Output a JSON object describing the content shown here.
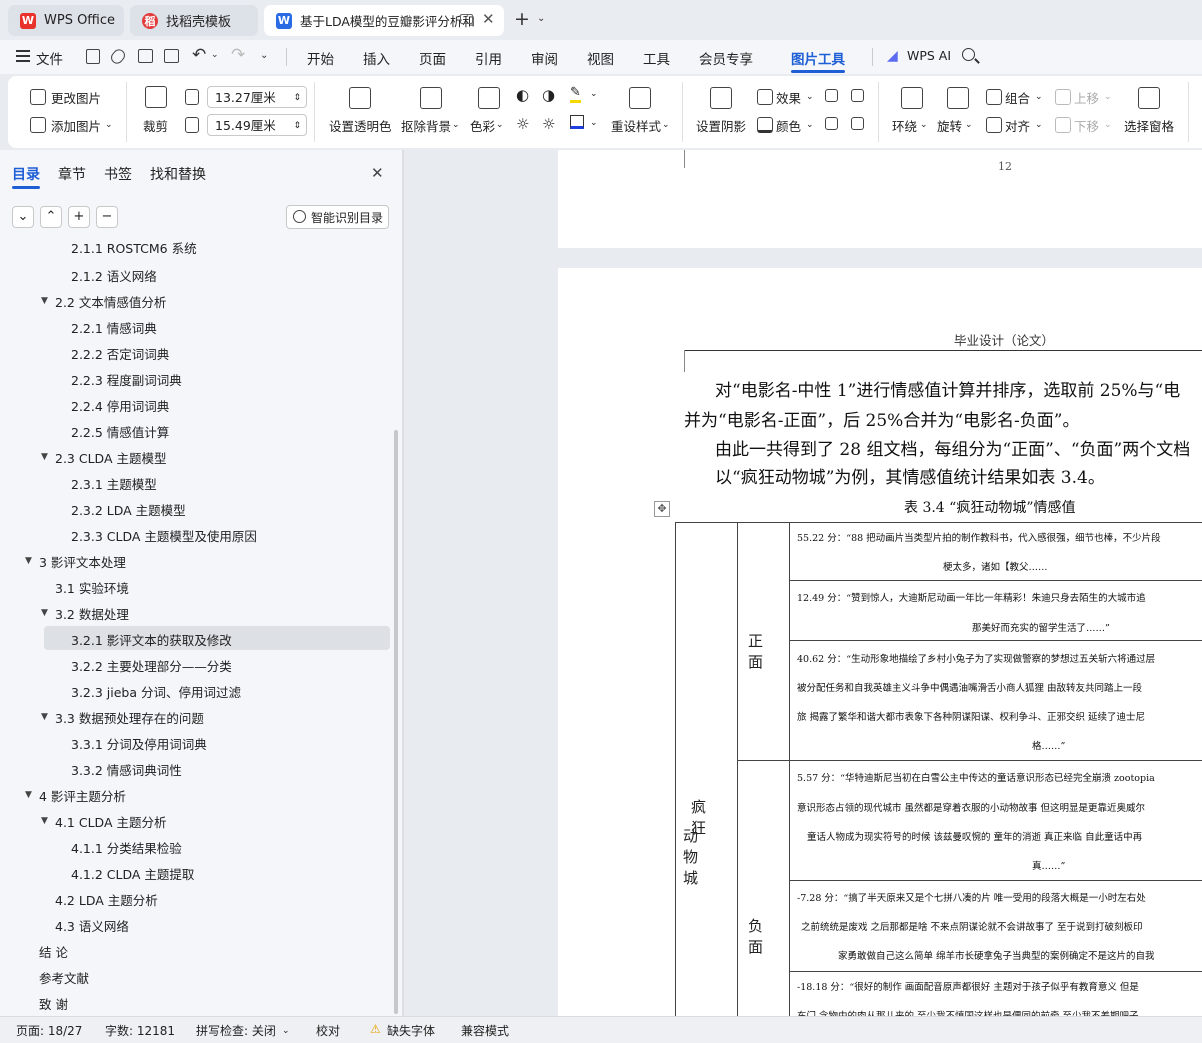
{
  "tabs": [
    {
      "label": "WPS Office",
      "icon": "wps-logo-icon"
    },
    {
      "label": "找稻壳模板",
      "icon": "docer-icon"
    },
    {
      "label": "基于LDA模型的豆瓣影评分析和",
      "icon": "writer-doc-icon"
    }
  ],
  "menu": {
    "file": "文件",
    "items": [
      "开始",
      "插入",
      "页面",
      "引用",
      "审阅",
      "视图",
      "工具",
      "会员专享",
      "图片工具"
    ],
    "wps_ai": "WPS AI"
  },
  "ribbon": {
    "change_image": "更改图片",
    "add_image": "添加图片",
    "crop": "裁剪",
    "width": "13.27厘米",
    "height": "15.49厘米",
    "set_transparent": "设置透明色",
    "remove_bg": "抠除背景",
    "color": "色彩",
    "reset_style": "重设样式",
    "set_shadow": "设置阴影",
    "effect": "效果",
    "fill_color": "颜色",
    "wrap": "环绕",
    "rotate": "旋转",
    "group": "组合",
    "align": "对齐",
    "move_up": "上移",
    "move_down": "下移",
    "select_pane": "选择窗格"
  },
  "sidebar": {
    "tabs": [
      "目录",
      "章节",
      "书签",
      "找和替换"
    ],
    "smart_toc": "智能识别目录",
    "items": [
      {
        "label": "2.1.1 ROSTCM6 系统",
        "level": 3
      },
      {
        "label": "2.1.2 语义网络",
        "level": 3
      },
      {
        "label": "2.2 文本情感值分析",
        "level": 2
      },
      {
        "label": "2.2.1 情感词典",
        "level": 3
      },
      {
        "label": "2.2.2 否定词词典",
        "level": 3
      },
      {
        "label": "2.2.3 程度副词词典",
        "level": 3
      },
      {
        "label": "2.2.4 停用词词典",
        "level": 3
      },
      {
        "label": "2.2.5 情感值计算",
        "level": 3
      },
      {
        "label": "2.3 CLDA 主题模型",
        "level": 2
      },
      {
        "label": "2.3.1 主题模型",
        "level": 3
      },
      {
        "label": "2.3.2 LDA 主题模型",
        "level": 3
      },
      {
        "label": "2.3.3 CLDA 主题模型及使用原因",
        "level": 3
      },
      {
        "label": "3 影评文本处理",
        "level": 1
      },
      {
        "label": "3.1 实验环境",
        "level": 2
      },
      {
        "label": "3.2 数据处理",
        "level": 2
      },
      {
        "label": "3.2.1 影评文本的获取及修改",
        "level": 3
      },
      {
        "label": "3.2.2 主要处理部分——分类",
        "level": 3
      },
      {
        "label": "3.2.3 jieba 分词、停用词过滤",
        "level": 3
      },
      {
        "label": "3.3 数据预处理存在的问题",
        "level": 2
      },
      {
        "label": "3.3.1 分词及停用词词典",
        "level": 3
      },
      {
        "label": "3.3.2 情感词典词性",
        "level": 3
      },
      {
        "label": "4 影评主题分析",
        "level": 1
      },
      {
        "label": "4.1 CLDA 主题分析",
        "level": 2
      },
      {
        "label": "4.1.1 分类结果检验",
        "level": 3
      },
      {
        "label": "4.1.2 CLDA 主题提取",
        "level": 3
      },
      {
        "label": "4.2 LDA 主题分析",
        "level": 2
      },
      {
        "label": "4.3 语义网络",
        "level": 2
      },
      {
        "label": "结 论",
        "level": 1
      },
      {
        "label": "参考文献",
        "level": 1
      },
      {
        "label": "致 谢",
        "level": 1
      }
    ]
  },
  "document": {
    "page_number": "12",
    "header": "毕业设计（论文）",
    "para1_line1": "对“电影名-中性 1”进行情感值计算并排序，选取前 25%与“电",
    "para1_line2": "并为“电影名-正面”，后 25%合并为“电影名-负面”。",
    "para2_line1": "由此一共得到了 28 组文档，每组分为“正面”、“负面”两个文档",
    "para2_line2": "以“疯狂动物城”为例，其情感值统计结果如表 3.4。",
    "table_caption": "表 3.4 “疯狂动物城”情感值",
    "movie_line1": "疯狂",
    "movie_line2": "动物城",
    "positive": "正面",
    "negative": "负面",
    "rows": [
      [
        "55.22 分：“88 把动画片当类型片拍的制作教科书，代入感很强，细节也棒，不少片段",
        "梗太多，诸如【教父……"
      ],
      [
        "12.49 分：“赞到惊人，大迪斯尼动画一年比一年精彩！朱迪只身去陌生的大城市追",
        "那美好而充实的留学生活了……”"
      ],
      [
        "40.62 分：“生动形象地描绘了乡村小兔子为了实现做警察的梦想过五关斩六将通过层",
        "被分配任务和自我英雄主义斗争中偶遇油嘴滑舌小商人狐狸 由敌转友共同踏上一段",
        "旅 揭露了繁华和谐大都市表象下各种阴谋阳谋、权利争斗、正邪交织 延续了迪士尼",
        "格……”"
      ],
      [
        "5.57 分：“华特迪斯尼当初在白雪公主中传达的童话意识形态已经完全崩溃 zootopia",
        "意识形态占领的现代城市 虽然都是穿着衣服的小动物故事 但这明显是更靠近奥威尔",
        "童话人物成为现实符号的时候 该兹曼叹惋的 童年的消逝 真正来临 自此童话中再",
        "真……”"
      ],
      [
        "-7.28 分：“搞了半天原来又是个七拼八凑的片 唯一受用的段落大概是一小时左右处",
        "之前统统是废戏 之后那都是啥 不来点阴谋论就不会讲故事了 至于说到打破刻板印",
        "家勇敢做自己这么简单 绵羊市长硬拿兔子当典型的案例确定不是这片的自我",
        "-18.18 分：“很好的制作 画面配音原声都很好 主题对于孩子似乎有教育意义 但是"
      ],
      [
        "-18.18 分：“很好的制作 画面配音原声都很好 主题对于孩子似乎有教育意义 但是",
        "东门 念物中的肉从那儿来的 至少我不慎国这样也是偶同的前牵 至少我不差期吧子"
      ]
    ]
  },
  "status": {
    "page": "页面: 18/27",
    "words": "字数: 12181",
    "spell": "拼写检查: 关闭",
    "proof": "校对",
    "missing_font": "缺失字体",
    "compat": "兼容模式"
  }
}
